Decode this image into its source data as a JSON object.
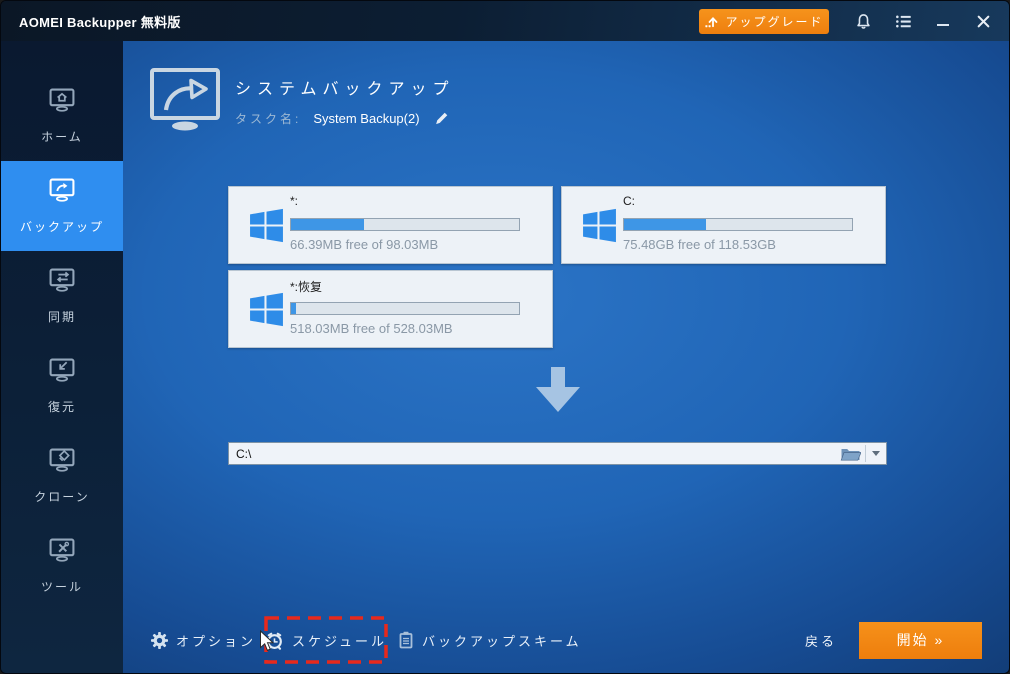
{
  "titlebar": {
    "app_title": "AOMEI Backupper 無料版",
    "upgrade_label": "アップグレード"
  },
  "sidebar": {
    "items": [
      {
        "label": "ホーム",
        "selected": false
      },
      {
        "label": "バックアップ",
        "selected": true
      },
      {
        "label": "同期",
        "selected": false
      },
      {
        "label": "復元",
        "selected": false
      },
      {
        "label": "クローン",
        "selected": false
      },
      {
        "label": "ツール",
        "selected": false
      }
    ]
  },
  "header": {
    "title": "システムバックアップ",
    "task_label": "タスク名:",
    "task_name": "System Backup(2)"
  },
  "partitions": [
    {
      "name": "*:",
      "free_text": "66.39MB free of 98.03MB",
      "used_pct": 32
    },
    {
      "name": "C:",
      "free_text": "75.48GB free of 118.53GB",
      "used_pct": 36
    },
    {
      "name": "*:恢复",
      "free_text": "518.03MB free of 528.03MB",
      "used_pct": 2
    }
  ],
  "destination": {
    "path": "C:\\"
  },
  "toolbar": {
    "options": "オプション",
    "schedule": "スケジュール",
    "scheme": "バックアップスキーム",
    "back": "戻る",
    "start": "開始 »"
  },
  "colors": {
    "accent_orange": "#f28a15",
    "selected_blue": "#2f8ef0",
    "windows_logo_blue": "#2e8ce8",
    "highlight_red": "#e8291c",
    "progress_fill": "#3e96e6"
  },
  "icons": {
    "upgrade": "up-arrow-with-dots",
    "notifications": "bell",
    "menu": "list-menu",
    "minimize": "dash",
    "close": "x",
    "home": "monitor-home",
    "backup": "monitor-share-arrow",
    "sync": "monitor-sync-arrows",
    "restore": "monitor-return-arrow",
    "clone": "monitor-diamond",
    "tools": "monitor-cross-tools",
    "header": "monitor-curved-arrow",
    "partition": "windows-logo",
    "destination_browse": "open-folder",
    "destination_dropdown": "caret-down",
    "flow": "big-down-arrow",
    "options": "gear",
    "schedule": "alarm-clock",
    "scheme": "clipboard-list",
    "task_edit": "pencil",
    "pointer": "mouse-cursor-arrow"
  }
}
